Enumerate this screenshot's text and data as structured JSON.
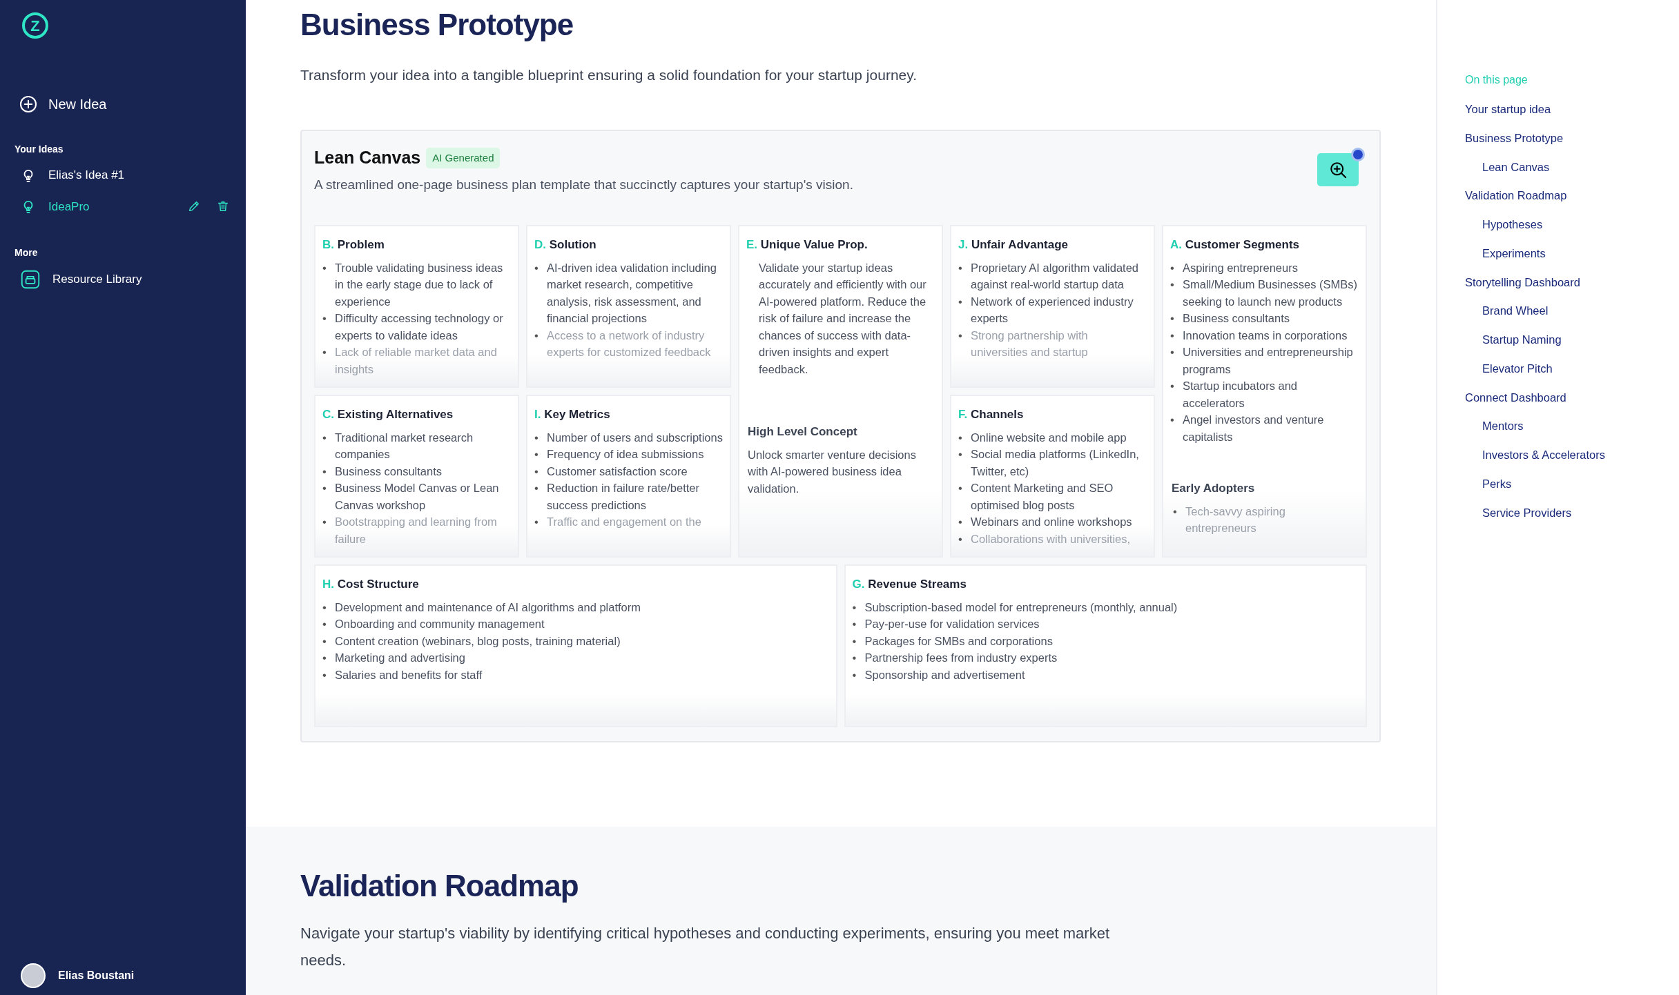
{
  "sidebar": {
    "logo": {
      "mark": "Z"
    },
    "new_idea": {
      "label": "New Idea"
    },
    "sections": [
      {
        "title": "Your Ideas",
        "kind": "ideas",
        "items": [
          {
            "label": "Elias's Idea #1",
            "selected": false
          },
          {
            "label": "IdeaPro",
            "selected": true
          }
        ]
      },
      {
        "title": "More",
        "kind": "links",
        "items": [
          {
            "label": "Resource Library",
            "selected": false
          }
        ]
      }
    ],
    "user": {
      "name": "Elias Boustani"
    }
  },
  "business_prototype": {
    "title": "Business Prototype",
    "description": "Transform your idea into a tangible blueprint ensuring a solid foundation for your startup journey.",
    "lean_canvas": {
      "title": "Lean Canvas",
      "badge": "AI Generated",
      "description": "A streamlined one-page business plan template that succinctly captures your startup's vision.",
      "zoom_button": {
        "notification": true
      },
      "bullet": "•",
      "columns": [
        {
          "blocks": [
            {
              "letter": "B.",
              "title": "Problem",
              "kind": "list",
              "items": [
                "Trouble validating business ideas in the early stage due to lack of experience",
                "Difficulty accessing technology or experts to validate ideas",
                "Lack of reliable market data and insights"
              ]
            },
            {
              "letter": "C.",
              "title": "Existing Alternatives",
              "kind": "list",
              "items": [
                "Traditional market research companies",
                "Business consultants",
                "Business Model Canvas or Lean Canvas workshop",
                "Bootstrapping and learning from failure"
              ]
            }
          ]
        },
        {
          "blocks": [
            {
              "letter": "D.",
              "title": "Solution",
              "kind": "list",
              "items": [
                "AI-driven idea validation including market research, competitive analysis, risk assessment, and financial projections",
                "Access to a network of industry experts for customized feedback"
              ]
            },
            {
              "letter": "I.",
              "title": "Key Metrics",
              "kind": "list",
              "items": [
                "Number of users and subscriptions",
                "Frequency of idea submissions",
                "Customer satisfaction score",
                "Reduction in failure rate/better success predictions",
                "Traffic and engagement on the"
              ]
            }
          ]
        },
        {
          "blocks": [
            {
              "letter": "E.",
              "title": "Unique Value Prop.",
              "kind": "text",
              "text": "Validate your startup ideas accurately and efficiently with our AI-powered platform. Reduce the risk of failure and increase the chances of success with data-driven insights and expert feedback.",
              "extra": {
                "title": "High Level Concept",
                "kind": "text",
                "text": "Unlock smarter venture decisions with AI-powered business idea validation."
              }
            }
          ]
        },
        {
          "blocks": [
            {
              "letter": "J.",
              "title": "Unfair Advantage",
              "kind": "list",
              "items": [
                "Proprietary AI algorithm validated against real-world startup data",
                "Network of experienced industry experts",
                "Strong partnership with universities and startup"
              ]
            },
            {
              "letter": "F.",
              "title": "Channels",
              "kind": "list",
              "items": [
                "Online website and mobile app",
                "Social media platforms (LinkedIn, Twitter, etc)",
                "Content Marketing and SEO optimised blog posts",
                "Webinars and online workshops",
                "Collaborations with universities,"
              ]
            }
          ]
        },
        {
          "blocks": [
            {
              "letter": "A.",
              "title": "Customer Segments",
              "kind": "list",
              "items": [
                "Aspiring entrepreneurs",
                "Small/Medium Businesses (SMBs) seeking to launch new products",
                "Business consultants",
                "Innovation teams in corporations",
                "Universities and entrepreneurship programs",
                "Startup incubators and accelerators",
                "Angel investors and venture capitalists"
              ],
              "extra": {
                "title": "Early Adopters",
                "kind": "list",
                "items": [
                  "Tech-savvy aspiring entrepreneurs"
                ]
              }
            }
          ]
        }
      ],
      "bottom_blocks": [
        {
          "letter": "H.",
          "title": "Cost Structure",
          "kind": "list",
          "items": [
            "Development and maintenance of AI algorithms and platform",
            "Onboarding and community management",
            "Content creation (webinars, blog posts, training material)",
            "Marketing and advertising",
            "Salaries and benefits for staff"
          ]
        },
        {
          "letter": "G.",
          "title": "Revenue Streams",
          "kind": "list",
          "items": [
            "Subscription-based model for entrepreneurs (monthly, annual)",
            "Pay-per-use for validation services",
            "Packages for SMBs and corporations",
            "Partnership fees from industry experts",
            "Sponsorship and advertisement"
          ]
        }
      ]
    }
  },
  "validation_roadmap": {
    "title": "Validation Roadmap",
    "description": "Navigate your startup's viability by identifying critical hypotheses and conducting experiments, ensuring you meet market needs."
  },
  "toc": {
    "title": "On this page",
    "items": [
      {
        "label": "Your startup idea"
      },
      {
        "label": "Business Prototype",
        "children": [
          {
            "label": "Lean Canvas"
          }
        ]
      },
      {
        "label": "Validation Roadmap",
        "children": [
          {
            "label": "Hypotheses"
          },
          {
            "label": "Experiments"
          }
        ]
      },
      {
        "label": "Storytelling Dashboard",
        "children": [
          {
            "label": "Brand Wheel"
          },
          {
            "label": "Startup Naming"
          },
          {
            "label": "Elevator Pitch"
          }
        ]
      },
      {
        "label": "Connect Dashboard",
        "children": [
          {
            "label": "Mentors"
          },
          {
            "label": "Investors & Accelerators"
          },
          {
            "label": "Perks"
          },
          {
            "label": "Service Providers"
          }
        ]
      }
    ]
  }
}
